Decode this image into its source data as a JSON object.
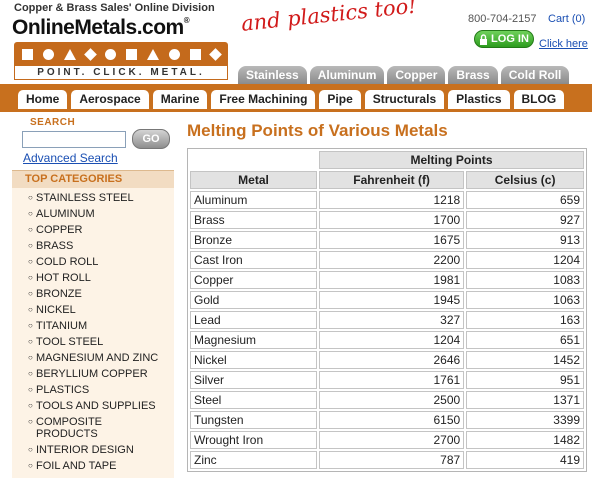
{
  "header": {
    "tagline": "Copper & Brass Sales' Online Division",
    "logo_text": "OnlineMetals.com",
    "logo_reg": "®",
    "logo_slogan": "POINT.   CLICK.   METAL.",
    "plastics_slogan": "and plastics too!",
    "phone": "800-704-2157",
    "cart": "Cart (0)",
    "login_label": "LOG IN",
    "help": "Click here"
  },
  "metal_tabs": [
    "Stainless",
    "Aluminum",
    "Copper",
    "Brass",
    "Cold Roll"
  ],
  "nav": [
    "Home",
    "Aerospace",
    "Marine",
    "Free Machining",
    "Pipe",
    "Structurals",
    "Plastics",
    "BLOG"
  ],
  "sidebar": {
    "search_label": "SEARCH",
    "search_value": "",
    "go_label": "GO",
    "advanced_search": "Advanced Search",
    "top_categories_label": "TOP CATEGORIES",
    "categories": [
      "STAINLESS STEEL",
      "ALUMINUM",
      "COPPER",
      "BRASS",
      "COLD ROLL",
      "HOT ROLL",
      "BRONZE",
      "NICKEL",
      "TITANIUM",
      "TOOL STEEL",
      "MAGNESIUM AND ZINC",
      "BERYLLIUM COPPER",
      "PLASTICS",
      "TOOLS AND SUPPLIES",
      "COMPOSITE PRODUCTS",
      "INTERIOR DESIGN",
      "FOIL AND TAPE"
    ]
  },
  "main": {
    "title": "Melting Points of Various Metals",
    "table": {
      "group_header": "Melting Points",
      "headers": [
        "Metal",
        "Fahrenheit (f)",
        "Celsius (c)"
      ],
      "rows": [
        [
          "Aluminum",
          "1218",
          "659"
        ],
        [
          "Brass",
          "1700",
          "927"
        ],
        [
          "Bronze",
          "1675",
          "913"
        ],
        [
          "Cast Iron",
          "2200",
          "1204"
        ],
        [
          "Copper",
          "1981",
          "1083"
        ],
        [
          "Gold",
          "1945",
          "1063"
        ],
        [
          "Lead",
          "327",
          "163"
        ],
        [
          "Magnesium",
          "1204",
          "651"
        ],
        [
          "Nickel",
          "2646",
          "1452"
        ],
        [
          "Silver",
          "1761",
          "951"
        ],
        [
          "Steel",
          "2500",
          "1371"
        ],
        [
          "Tungsten",
          "6150",
          "3399"
        ],
        [
          "Wrought Iron",
          "2700",
          "1482"
        ],
        [
          "Zinc",
          "787",
          "419"
        ]
      ]
    }
  },
  "colors": {
    "brand_orange": "#c8701e",
    "link_blue": "#1a4fb3",
    "login_green": "#2d9c1e",
    "slogan_red": "#d11a1a"
  }
}
